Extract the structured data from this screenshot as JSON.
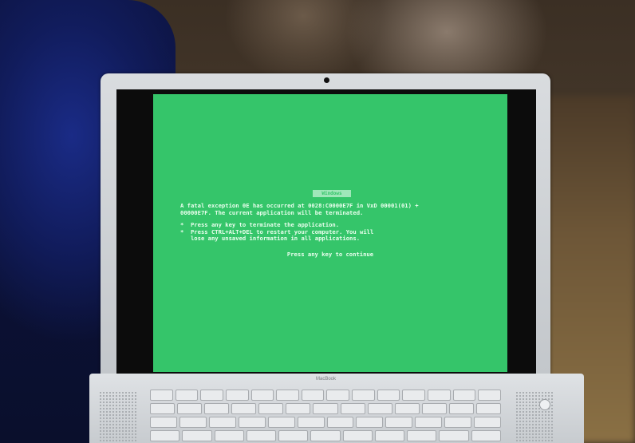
{
  "screen": {
    "title": "Windows",
    "message_lines": [
      "A fatal exception 0E has occurred at 0028:C0000E7F in VxD 00001(01) +",
      "00000E7F. The current application will be terminated."
    ],
    "bullets": [
      "*  Press any key to terminate the application.",
      "*  Press CTRL+ALT+DEL to restart your computer. You will",
      "   lose any unsaved information in all applications."
    ],
    "continue_text": "Press any key to continue",
    "background_color": "#35c56a",
    "text_color": "#eaffee"
  },
  "laptop": {
    "brand": "MacBook"
  }
}
